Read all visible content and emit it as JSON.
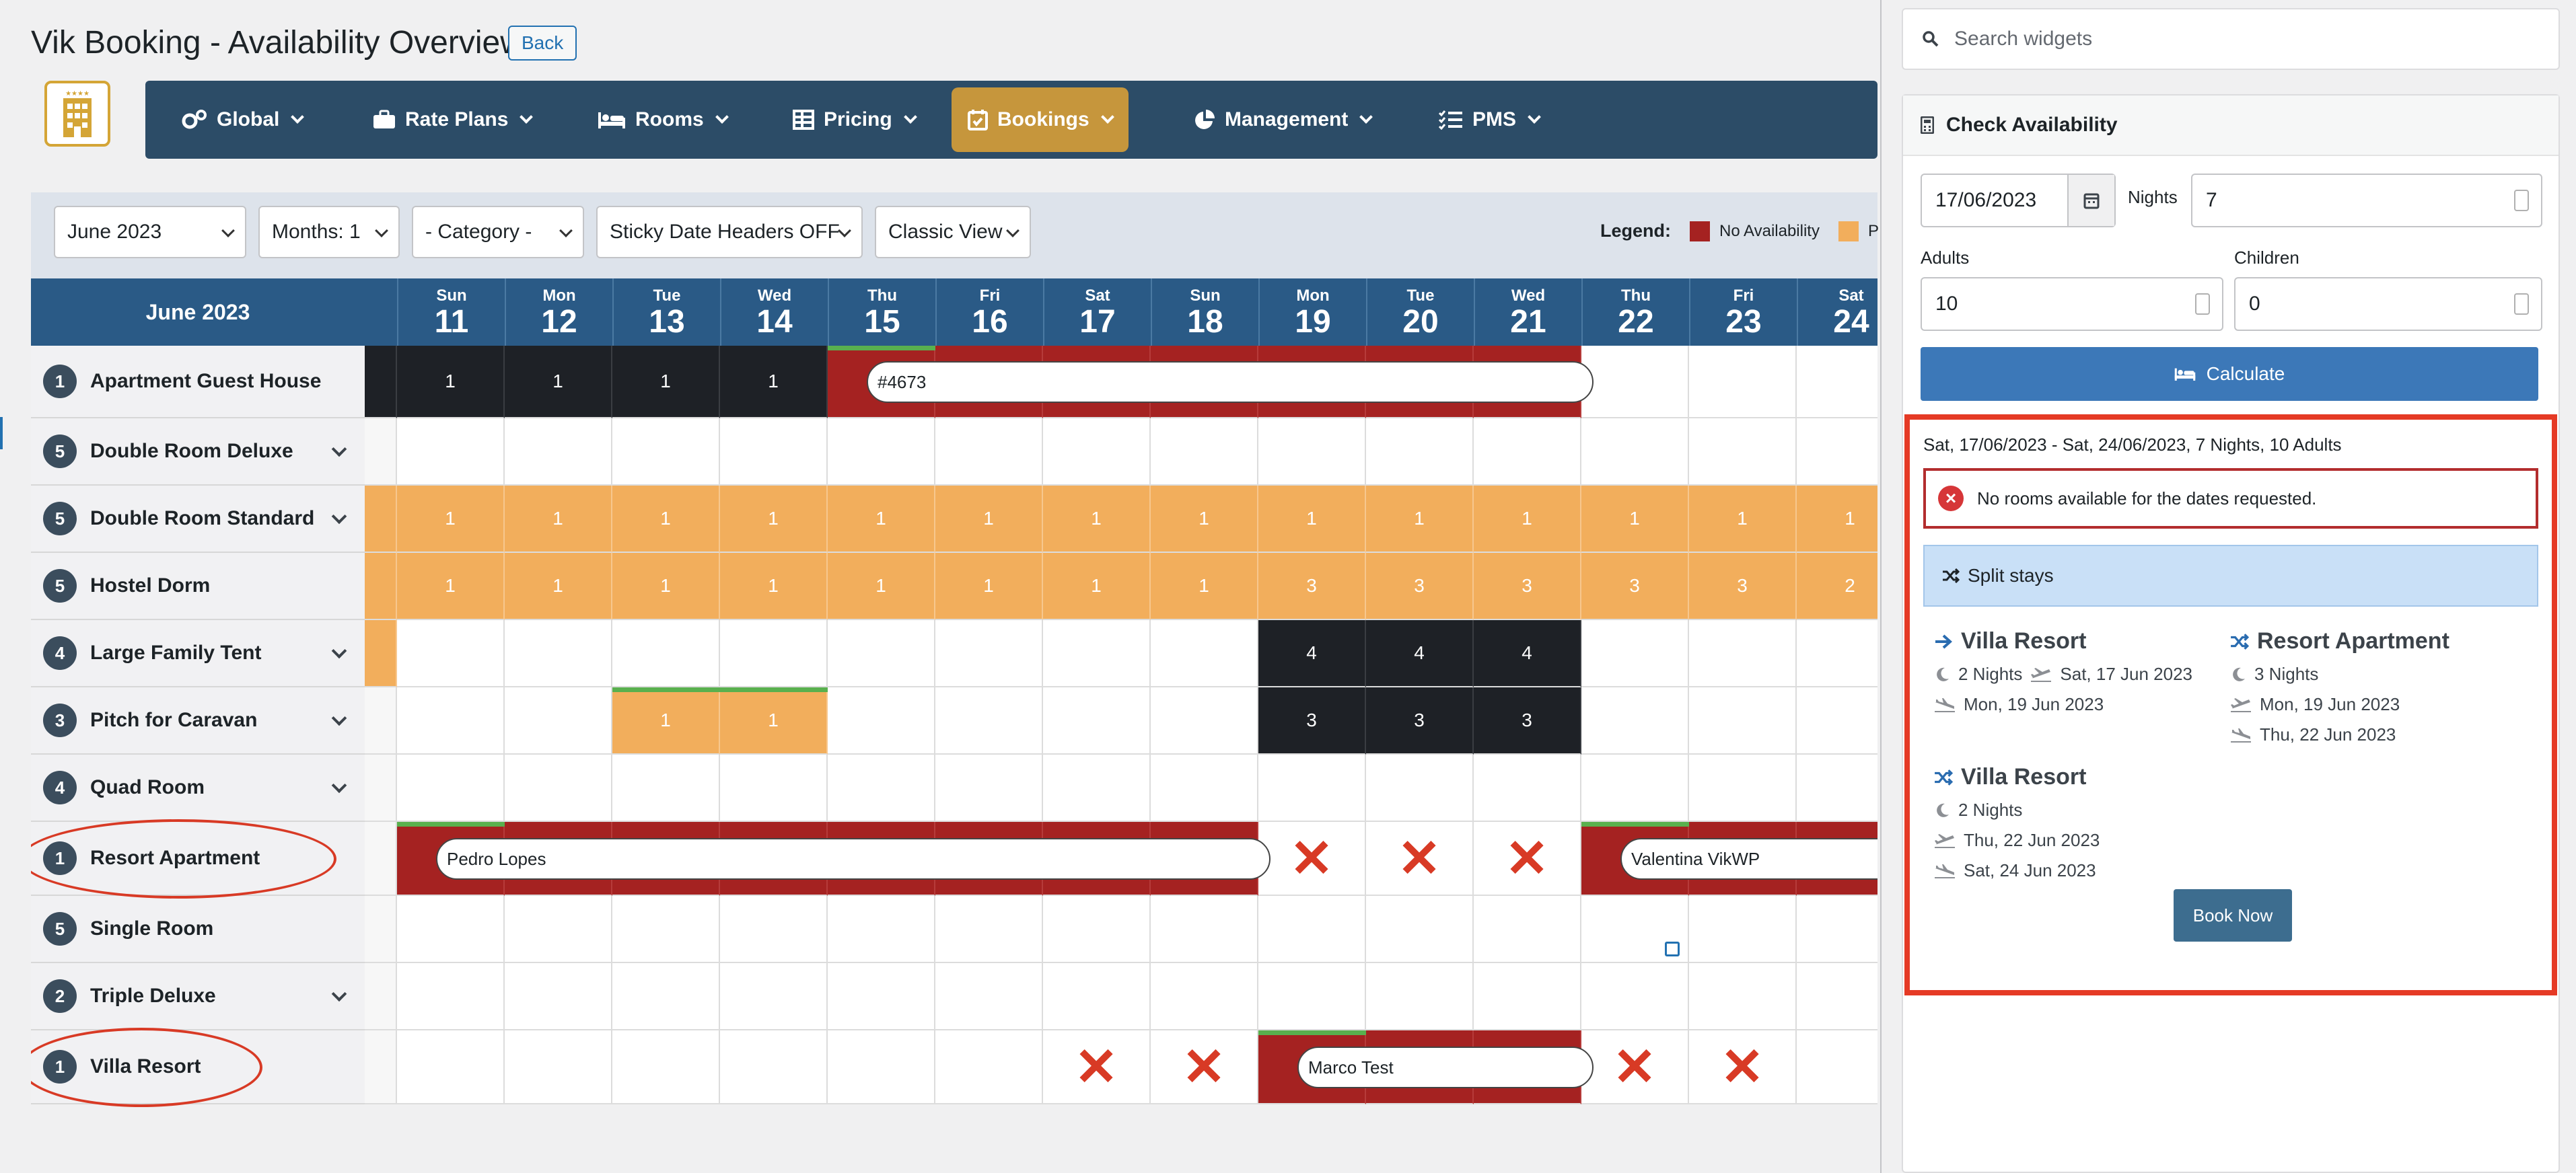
{
  "page": {
    "title": "Vik Booking - Availability Overview",
    "back_label": "Back"
  },
  "nav": [
    {
      "label": "Global",
      "icon": "gears-icon"
    },
    {
      "label": "Rate Plans",
      "icon": "briefcase-icon"
    },
    {
      "label": "Rooms",
      "icon": "bed-icon"
    },
    {
      "label": "Pricing",
      "icon": "table-icon"
    },
    {
      "label": "Bookings",
      "icon": "calendar-check-icon",
      "active": true
    },
    {
      "label": "Management",
      "icon": "pie-chart-icon"
    },
    {
      "label": "PMS",
      "icon": "list-check-icon"
    }
  ],
  "filters": {
    "month": "June 2023",
    "months": "Months: 1",
    "category": "- Category -",
    "sticky": "Sticky Date Headers OFF",
    "view": "Classic View"
  },
  "legend": {
    "label": "Legend:",
    "no_availability": "No Availability",
    "partial": "P",
    "colors": {
      "none": "#a52221",
      "partial": "#f2ae5c"
    }
  },
  "calendar": {
    "month_header": "June 2023",
    "days": [
      {
        "dn": "Sun",
        "d": "11"
      },
      {
        "dn": "Mon",
        "d": "12"
      },
      {
        "dn": "Tue",
        "d": "13"
      },
      {
        "dn": "Wed",
        "d": "14"
      },
      {
        "dn": "Thu",
        "d": "15"
      },
      {
        "dn": "Fri",
        "d": "16"
      },
      {
        "dn": "Sat",
        "d": "17"
      },
      {
        "dn": "Sun",
        "d": "18"
      },
      {
        "dn": "Mon",
        "d": "19"
      },
      {
        "dn": "Tue",
        "d": "20"
      },
      {
        "dn": "Wed",
        "d": "21"
      },
      {
        "dn": "Thu",
        "d": "22"
      },
      {
        "dn": "Fri",
        "d": "23"
      },
      {
        "dn": "Sat",
        "d": "24"
      }
    ],
    "rooms": [
      {
        "count": "1",
        "name": "Apartment Guest House",
        "expand": false,
        "cells": [
          [
            "blk",
            "1"
          ],
          [
            "blk",
            "1"
          ],
          [
            "blk",
            "1"
          ],
          [
            "blk",
            "1"
          ],
          [
            "red",
            ""
          ],
          [
            "red",
            ""
          ],
          [
            "red",
            ""
          ],
          [
            "red",
            ""
          ],
          [
            "red",
            ""
          ],
          [
            "red",
            ""
          ],
          [
            "red",
            ""
          ],
          [
            "w",
            ""
          ],
          [
            "w",
            ""
          ],
          [
            "w",
            ""
          ]
        ],
        "lead": "blk"
      },
      {
        "count": "5",
        "name": "Double Room Deluxe",
        "expand": true,
        "cells": [
          [
            "w",
            ""
          ],
          [
            "w",
            ""
          ],
          [
            "w",
            ""
          ],
          [
            "w",
            ""
          ],
          [
            "w",
            ""
          ],
          [
            "w",
            ""
          ],
          [
            "w",
            ""
          ],
          [
            "w",
            ""
          ],
          [
            "w",
            ""
          ],
          [
            "w",
            ""
          ],
          [
            "w",
            ""
          ],
          [
            "w",
            ""
          ],
          [
            "w",
            ""
          ],
          [
            "w",
            ""
          ]
        ],
        "lead": "w"
      },
      {
        "count": "5",
        "name": "Double Room Standard",
        "expand": true,
        "cells": [
          [
            "org",
            "1"
          ],
          [
            "org",
            "1"
          ],
          [
            "org",
            "1"
          ],
          [
            "org",
            "1"
          ],
          [
            "org",
            "1"
          ],
          [
            "org",
            "1"
          ],
          [
            "org",
            "1"
          ],
          [
            "org",
            "1"
          ],
          [
            "org",
            "1"
          ],
          [
            "org",
            "1"
          ],
          [
            "org",
            "1"
          ],
          [
            "org",
            "1"
          ],
          [
            "org",
            "1"
          ],
          [
            "org",
            "1"
          ]
        ],
        "lead": "org"
      },
      {
        "count": "5",
        "name": "Hostel Dorm",
        "expand": false,
        "cells": [
          [
            "org",
            "1"
          ],
          [
            "org",
            "1"
          ],
          [
            "org",
            "1"
          ],
          [
            "org",
            "1"
          ],
          [
            "org",
            "1"
          ],
          [
            "org",
            "1"
          ],
          [
            "org",
            "1"
          ],
          [
            "org",
            "1"
          ],
          [
            "org",
            "3"
          ],
          [
            "org",
            "3"
          ],
          [
            "org",
            "3"
          ],
          [
            "org",
            "3"
          ],
          [
            "org",
            "3"
          ],
          [
            "org",
            "2"
          ]
        ],
        "lead": "org"
      },
      {
        "count": "4",
        "name": "Large Family Tent",
        "expand": true,
        "cells": [
          [
            "w",
            ""
          ],
          [
            "w",
            ""
          ],
          [
            "w",
            ""
          ],
          [
            "w",
            ""
          ],
          [
            "w",
            ""
          ],
          [
            "w",
            ""
          ],
          [
            "w",
            ""
          ],
          [
            "w",
            ""
          ],
          [
            "blk",
            "4"
          ],
          [
            "blk",
            "4"
          ],
          [
            "blk",
            "4"
          ],
          [
            "w",
            ""
          ],
          [
            "w",
            ""
          ],
          [
            "w",
            ""
          ]
        ],
        "lead": "org"
      },
      {
        "count": "3",
        "name": "Pitch for Caravan",
        "expand": true,
        "cells": [
          [
            "w",
            ""
          ],
          [
            "w",
            ""
          ],
          [
            "org",
            "1"
          ],
          [
            "org",
            "1"
          ],
          [
            "w",
            ""
          ],
          [
            "w",
            ""
          ],
          [
            "w",
            ""
          ],
          [
            "w",
            ""
          ],
          [
            "blk",
            "3"
          ],
          [
            "blk",
            "3"
          ],
          [
            "blk",
            "3"
          ],
          [
            "w",
            ""
          ],
          [
            "w",
            ""
          ],
          [
            "w",
            ""
          ]
        ],
        "lead": "w"
      },
      {
        "count": "4",
        "name": "Quad Room",
        "expand": true,
        "cells": [
          [
            "w",
            ""
          ],
          [
            "w",
            ""
          ],
          [
            "w",
            ""
          ],
          [
            "w",
            ""
          ],
          [
            "w",
            ""
          ],
          [
            "w",
            ""
          ],
          [
            "w",
            ""
          ],
          [
            "w",
            ""
          ],
          [
            "w",
            ""
          ],
          [
            "w",
            ""
          ],
          [
            "w",
            ""
          ],
          [
            "w",
            ""
          ],
          [
            "w",
            ""
          ],
          [
            "w",
            ""
          ]
        ],
        "lead": "w"
      },
      {
        "count": "1",
        "name": "Resort Apartment",
        "expand": false,
        "cells": [
          [
            "red",
            ""
          ],
          [
            "red",
            ""
          ],
          [
            "red",
            ""
          ],
          [
            "red",
            ""
          ],
          [
            "red",
            ""
          ],
          [
            "red",
            ""
          ],
          [
            "red",
            ""
          ],
          [
            "red",
            ""
          ],
          [
            "x",
            ""
          ],
          [
            "x",
            ""
          ],
          [
            "x",
            ""
          ],
          [
            "red",
            ""
          ],
          [
            "red",
            ""
          ],
          [
            "red",
            ""
          ]
        ],
        "lead": "w"
      },
      {
        "count": "5",
        "name": "Single Room",
        "expand": false,
        "cells": [
          [
            "w",
            ""
          ],
          [
            "w",
            ""
          ],
          [
            "w",
            ""
          ],
          [
            "w",
            ""
          ],
          [
            "w",
            ""
          ],
          [
            "w",
            ""
          ],
          [
            "w",
            ""
          ],
          [
            "w",
            ""
          ],
          [
            "w",
            ""
          ],
          [
            "w",
            ""
          ],
          [
            "w",
            ""
          ],
          [
            "w",
            ""
          ],
          [
            "w",
            ""
          ],
          [
            "w",
            ""
          ]
        ],
        "lead": "w"
      },
      {
        "count": "2",
        "name": "Triple Deluxe",
        "expand": true,
        "cells": [
          [
            "w",
            ""
          ],
          [
            "w",
            ""
          ],
          [
            "w",
            ""
          ],
          [
            "w",
            ""
          ],
          [
            "w",
            ""
          ],
          [
            "w",
            ""
          ],
          [
            "w",
            ""
          ],
          [
            "w",
            ""
          ],
          [
            "w",
            ""
          ],
          [
            "w",
            ""
          ],
          [
            "w",
            ""
          ],
          [
            "w",
            ""
          ],
          [
            "w",
            ""
          ],
          [
            "w",
            ""
          ]
        ],
        "lead": "w"
      },
      {
        "count": "1",
        "name": "Villa Resort",
        "expand": false,
        "cells": [
          [
            "w",
            ""
          ],
          [
            "w",
            ""
          ],
          [
            "w",
            ""
          ],
          [
            "w",
            ""
          ],
          [
            "w",
            ""
          ],
          [
            "w",
            ""
          ],
          [
            "x",
            ""
          ],
          [
            "x",
            ""
          ],
          [
            "red",
            ""
          ],
          [
            "red",
            ""
          ],
          [
            "red",
            ""
          ],
          [
            "x",
            ""
          ],
          [
            "x",
            ""
          ],
          [
            "w",
            ""
          ]
        ],
        "lead": "w"
      }
    ],
    "bookings": [
      {
        "label": "#4673",
        "row": 0,
        "start": 4,
        "span": 7
      },
      {
        "label": "Pedro Lopes",
        "row": 7,
        "start": 0,
        "span": 8
      },
      {
        "label": "Valentina VikWP",
        "row": 7,
        "start": 11,
        "span": 4
      },
      {
        "label": "Marco Test",
        "row": 10,
        "start": 8,
        "span": 3
      }
    ],
    "x_mark": "✕"
  },
  "sidebar": {
    "search_placeholder": "Search widgets",
    "widget_title": "Check Availability",
    "checkin": "17/06/2023",
    "nights_label": "Nights",
    "nights": "7",
    "adults_label": "Adults",
    "adults": "10",
    "children_label": "Children",
    "children": "0",
    "calculate": "Calculate",
    "result_dates": "Sat, 17/06/2023 - Sat, 24/06/2023, 7 Nights, 10 Adults",
    "error": "No rooms available for the dates requested.",
    "split_label": "Split stays",
    "split": [
      {
        "name": "Villa Resort",
        "nights": "2 Nights",
        "checkin": "Sat, 17 Jun 2023",
        "checkout": "Mon, 19 Jun 2023"
      },
      {
        "name": "Resort Apartment",
        "nights": "3 Nights",
        "checkin": "Mon, 19 Jun 2023",
        "checkout": "Thu, 22 Jun 2023"
      },
      {
        "name": "Villa Resort",
        "nights": "2 Nights",
        "checkin": "Thu, 22 Jun 2023",
        "checkout": "Sat, 24 Jun 2023"
      }
    ],
    "book_now": "Book Now"
  }
}
